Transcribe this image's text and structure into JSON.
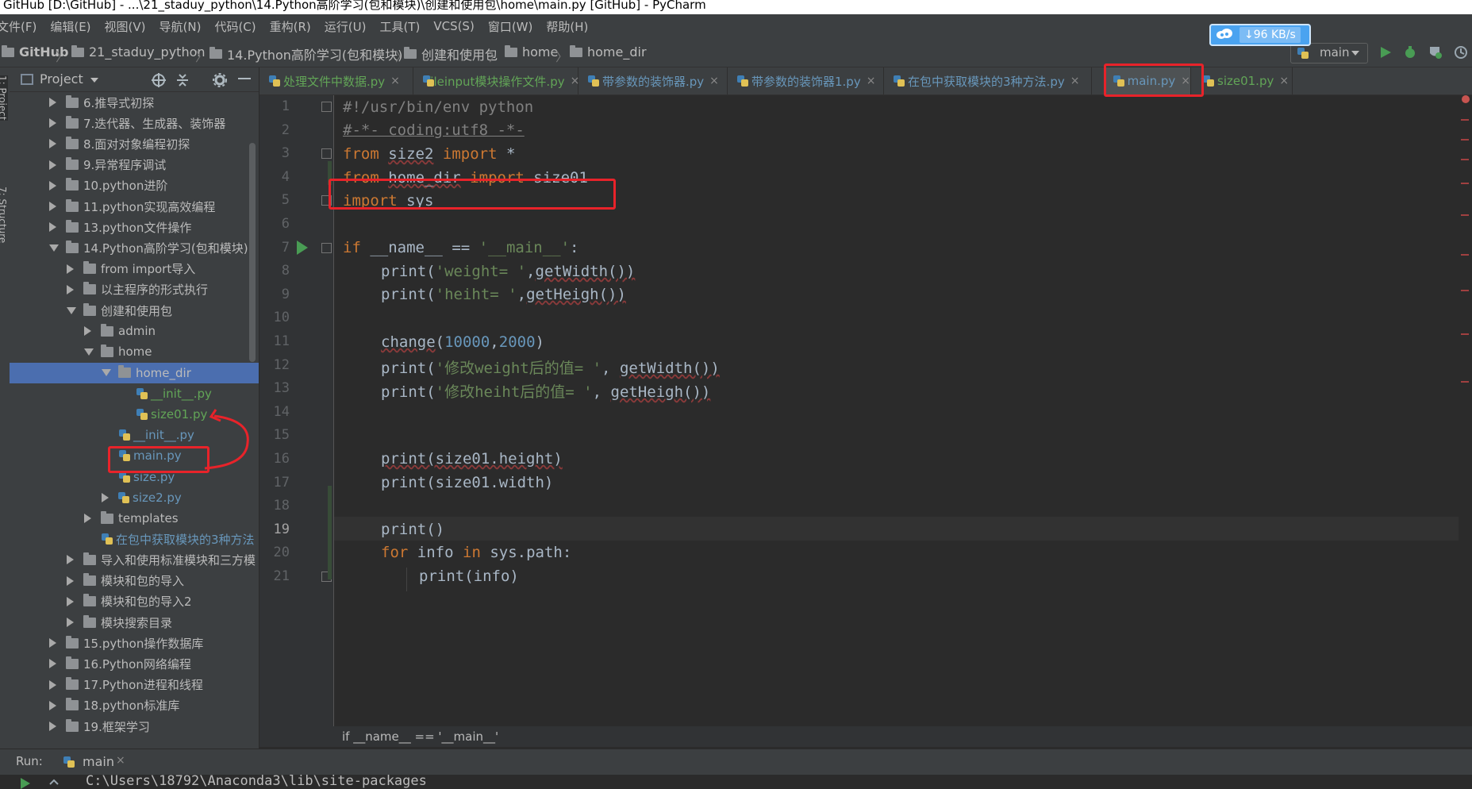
{
  "window": {
    "title": "GitHub [D:\\GitHub] - ...\\21_staduy_python\\14.Python高阶学习(包和模块)\\创建和使用包\\home\\main.py [GitHub] - PyCharm"
  },
  "menu": [
    "文件(F)",
    "编辑(E)",
    "视图(V)",
    "导航(N)",
    "代码(C)",
    "重构(R)",
    "运行(U)",
    "工具(T)",
    "VCS(S)",
    "窗口(W)",
    "帮助(H)"
  ],
  "breadcrumb": [
    "GitHub",
    "21_staduy_python",
    "14.Python高阶学习(包和模块)",
    "创建和使用包",
    "home",
    "home_dir"
  ],
  "netspeed": "↓96 KB/s",
  "run_config": "main",
  "left_strip": {
    "project": "1: Project",
    "structure": "7: Structure"
  },
  "project_panel": {
    "title": "Project"
  },
  "tree": [
    {
      "label": "6.推导式初探",
      "indent": 1,
      "type": "folder",
      "expanded": false
    },
    {
      "label": "7.迭代器、生成器、装饰器",
      "indent": 1,
      "type": "folder",
      "expanded": false
    },
    {
      "label": "8.面对对象编程初探",
      "indent": 1,
      "type": "folder",
      "expanded": false
    },
    {
      "label": "9.异常程序调试",
      "indent": 1,
      "type": "folder",
      "expanded": false
    },
    {
      "label": "10.python进阶",
      "indent": 1,
      "type": "folder",
      "expanded": false
    },
    {
      "label": "11.python实现高效编程",
      "indent": 1,
      "type": "folder",
      "expanded": false
    },
    {
      "label": "13.python文件操作",
      "indent": 1,
      "type": "folder",
      "expanded": false
    },
    {
      "label": "14.Python高阶学习(包和模块)",
      "indent": 1,
      "type": "folder",
      "expanded": true
    },
    {
      "label": "from import导入",
      "indent": 2,
      "type": "folder",
      "expanded": false
    },
    {
      "label": "以主程序的形式执行",
      "indent": 2,
      "type": "folder",
      "expanded": false
    },
    {
      "label": "创建和使用包",
      "indent": 2,
      "type": "folder",
      "expanded": true
    },
    {
      "label": "admin",
      "indent": 3,
      "type": "folder",
      "expanded": false
    },
    {
      "label": "home",
      "indent": 3,
      "type": "folder",
      "expanded": true
    },
    {
      "label": "home_dir",
      "indent": 4,
      "type": "folder",
      "expanded": true,
      "selected": true
    },
    {
      "label": "__init__.py",
      "indent": 5,
      "type": "py",
      "color": "green"
    },
    {
      "label": "size01.py",
      "indent": 5,
      "type": "py",
      "color": "green"
    },
    {
      "label": "__init__.py",
      "indent": 4,
      "type": "py",
      "color": "blue"
    },
    {
      "label": "main.py",
      "indent": 4,
      "type": "py",
      "color": "blue"
    },
    {
      "label": "size.py",
      "indent": 4,
      "type": "py",
      "color": "blue"
    },
    {
      "label": "size2.py",
      "indent": 4,
      "type": "py",
      "color": "blue",
      "expandable": true
    },
    {
      "label": "templates",
      "indent": 3,
      "type": "folder",
      "expanded": false
    },
    {
      "label": "在包中获取模块的3种方法",
      "indent": 3,
      "type": "py",
      "color": "blue"
    },
    {
      "label": "导入和使用标准模块和三方模",
      "indent": 2,
      "type": "folder",
      "expanded": false
    },
    {
      "label": "模块和包的导入",
      "indent": 2,
      "type": "folder",
      "expanded": false
    },
    {
      "label": "模块和包的导入2",
      "indent": 2,
      "type": "folder",
      "expanded": false
    },
    {
      "label": "模块搜索目录",
      "indent": 2,
      "type": "folder",
      "expanded": false
    },
    {
      "label": "15.python操作数据库",
      "indent": 1,
      "type": "folder",
      "expanded": false
    },
    {
      "label": "16.Python网络编程",
      "indent": 1,
      "type": "folder",
      "expanded": false
    },
    {
      "label": "17.Python进程和线程",
      "indent": 1,
      "type": "folder",
      "expanded": false
    },
    {
      "label": "18.python标准库",
      "indent": 1,
      "type": "folder",
      "expanded": false
    },
    {
      "label": "19.框架学习",
      "indent": 1,
      "type": "folder",
      "expanded": false
    }
  ],
  "tabs": [
    {
      "label": "处理文件中数据.py",
      "color": "#62a557",
      "close": "×"
    },
    {
      "label": "fileinput模块操作文件.py",
      "color": "#62a557",
      "close": "×"
    },
    {
      "label": "带参数的装饰器.py",
      "color": "#6897bb",
      "close": "×"
    },
    {
      "label": "带参数的装饰器1.py",
      "color": "#6897bb",
      "close": "×"
    },
    {
      "label": "在包中获取模块的3种方法.py",
      "color": "#6897bb",
      "close": "×"
    },
    {
      "label": "main.py",
      "color": "#6897bb",
      "close": "×",
      "active": true
    },
    {
      "label": "size01.py",
      "color": "#62a557",
      "close": "×"
    }
  ],
  "code_lines": [
    "1",
    "2",
    "3",
    "4",
    "5",
    "6",
    "7",
    "8",
    "9",
    "10",
    "11",
    "12",
    "13",
    "14",
    "15",
    "16",
    "17",
    "18",
    "19",
    "20",
    "21"
  ],
  "code": {
    "l1": "#!/usr/bin/env python",
    "l2": "#-*- coding:utf8 -*-",
    "l3_kw1": "from",
    "l3_mod": "size2",
    "l3_kw2": "import",
    "l3_rest": "*",
    "l4_kw1": "from",
    "l4_mod": "home_dir",
    "l4_kw2": "import",
    "l4_rest": "size01",
    "l5_kw": "import",
    "l5_rest": "sys",
    "l7_kw": "if",
    "l7_name": "__name__",
    "l7_op": "==",
    "l7_str": "'__main__'",
    "l7_colon": ":",
    "l8_fn": "print",
    "l8_str": "'weight= '",
    "l8_rest": "getWidth())",
    "l9_fn": "print",
    "l9_str": "'heiht= '",
    "l9_rest": "getHeigh())",
    "l11_fn": "change",
    "l11_n1": "10000",
    "l11_n2": "2000",
    "l12_fn": "print",
    "l12_str": "'修改weight后的值= '",
    "l12_rest": "getWidth())",
    "l13_fn": "print",
    "l13_str": "'修改heiht后的值= '",
    "l13_rest": "getHeigh())",
    "l16": "print(size01.height)",
    "l17": "print(size01.width)",
    "l19": "print()",
    "l20_kw1": "for",
    "l20_mid": "info",
    "l20_kw2": "in",
    "l20_rest": "sys.path:",
    "l21": "print(info)"
  },
  "editor_crumb": "if __name__ == '__main__'",
  "run_panel": {
    "label": "Run:",
    "tab": "main",
    "close": "×",
    "output": "C:\\Users\\18792\\Anaconda3\\lib\\site-packages"
  }
}
